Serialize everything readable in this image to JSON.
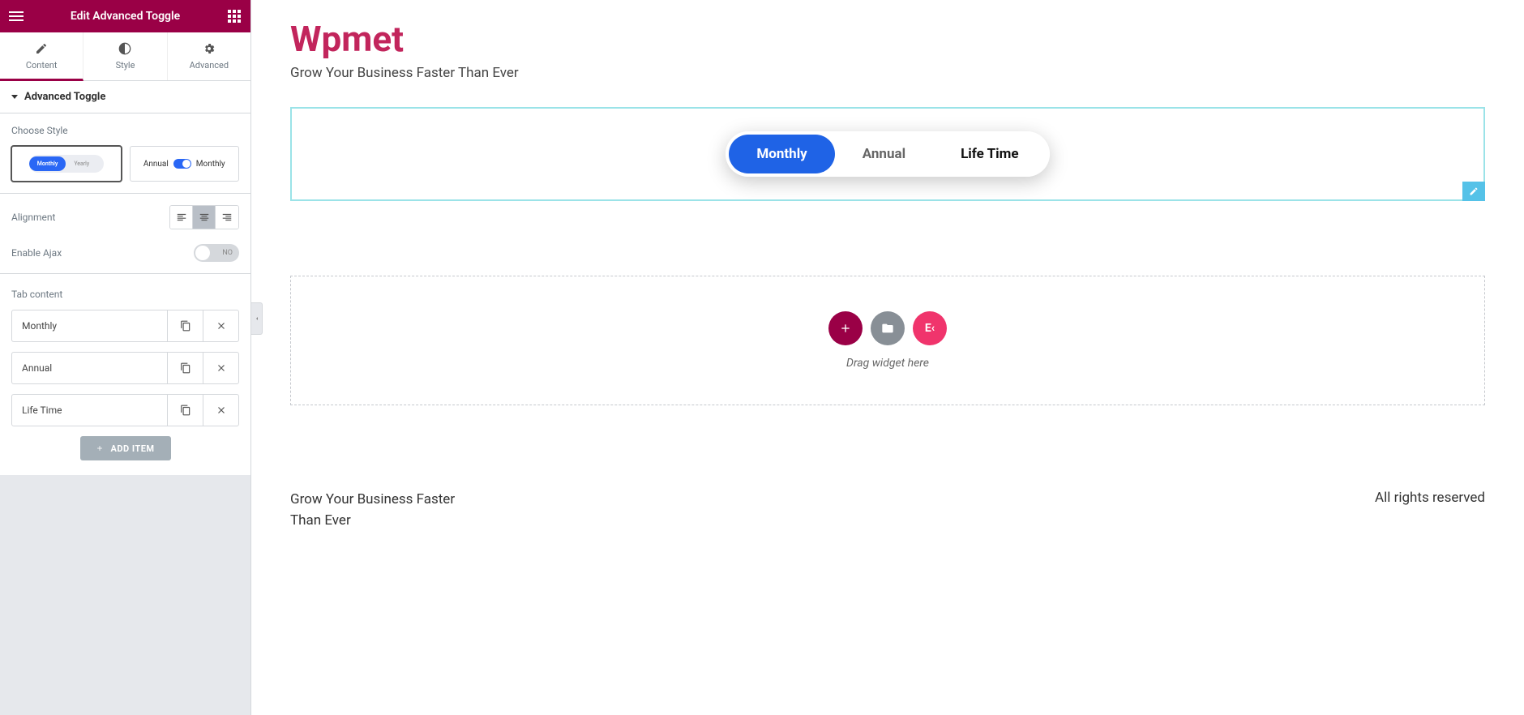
{
  "sidebar": {
    "title": "Edit Advanced Toggle",
    "tabs": {
      "content": "Content",
      "style": "Style",
      "advanced": "Advanced"
    },
    "section": "Advanced Toggle",
    "choose_style_label": "Choose Style",
    "style1": {
      "on": "Monthly",
      "off": "Yearly"
    },
    "style2": {
      "left": "Annual",
      "right": "Monthly"
    },
    "alignment_label": "Alignment",
    "ajax_label": "Enable Ajax",
    "ajax_value": "NO",
    "tab_content_label": "Tab content",
    "items": [
      {
        "label": "Monthly"
      },
      {
        "label": "Annual"
      },
      {
        "label": "Life Time"
      }
    ],
    "add_item": "ADD ITEM"
  },
  "main": {
    "brand": "Wpmet",
    "tagline": "Grow Your Business Faster Than Ever",
    "toggle": {
      "opt1": "Monthly",
      "opt2": "Annual",
      "opt3": "Life Time"
    },
    "dropzone_text": "Drag widget here",
    "footer_left": "Grow Your Business Faster Than Ever",
    "footer_right": "All rights reserved",
    "ek_label": "E‹"
  }
}
